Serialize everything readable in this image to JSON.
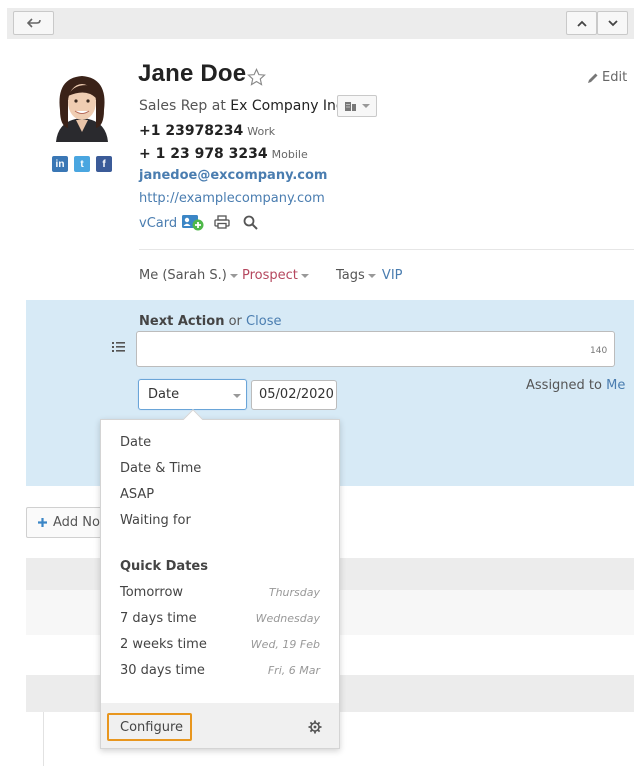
{
  "contact": {
    "name": "Jane Doe",
    "title_prefix": "Sales Rep at",
    "company": "Ex Company Inc",
    "phone_work": "+1 23978234",
    "phone_work_label": "Work",
    "phone_mobile": "+ 1 23 978 3234",
    "phone_mobile_label": "Mobile",
    "email": "janedoe@excompany.com",
    "website": "http://examplecompany.com",
    "vcard": "vCard",
    "edit_label": "Edit"
  },
  "meta": {
    "owner": "Me (Sarah S.)",
    "status": "Prospect",
    "tags_label": "Tags",
    "tag_value": "VIP"
  },
  "next_action": {
    "title": "Next Action",
    "or": "or",
    "close": "Close",
    "char_count": "140",
    "date_type": "Date",
    "date_value": "05/02/2020",
    "assigned_label": "Assigned to",
    "assigned_to": "Me"
  },
  "add_note": "Add Not",
  "dropdown": {
    "items": [
      "Date",
      "Date & Time",
      "ASAP",
      "Waiting for"
    ],
    "quick_header": "Quick Dates",
    "quick": [
      {
        "label": "Tomorrow",
        "day": "Thursday"
      },
      {
        "label": "7 days time",
        "day": "Wednesday"
      },
      {
        "label": "2 weeks time",
        "day": "Wed, 19 Feb"
      },
      {
        "label": "30 days time",
        "day": "Fri, 6 Mar"
      }
    ],
    "configure": "Configure"
  },
  "social": [
    "in",
    "t",
    "f"
  ],
  "icons": [
    "back-icon",
    "chevron-up-icon",
    "chevron-down-icon",
    "star-icon",
    "pencil-icon",
    "company-card-icon",
    "add-contact-icon",
    "print-icon",
    "search-icon",
    "list-icon",
    "gear-icon"
  ],
  "colors": {
    "accent": "#4a7db0",
    "prospect": "#b5475e",
    "panel": "#d7eaf6",
    "highlight": "#e8961e"
  }
}
